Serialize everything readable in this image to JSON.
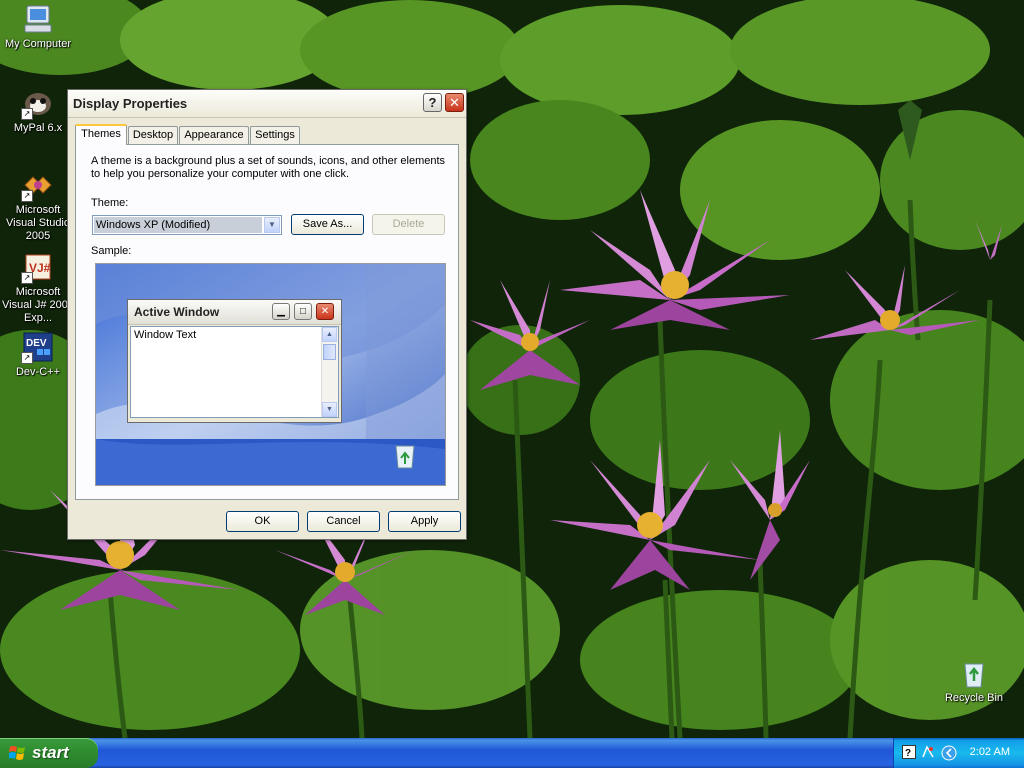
{
  "desktop": {
    "icons": [
      {
        "label": "My Computer"
      },
      {
        "label": "MyPal 6.x"
      },
      {
        "label": "Microsoft Visual Studio 2005"
      },
      {
        "label": "Microsoft Visual J# 2005 Exp..."
      },
      {
        "label": "Dev-C++"
      },
      {
        "label": "Recycle Bin"
      }
    ]
  },
  "dialog": {
    "title": "Display Properties",
    "help_glyph": "?",
    "close_glyph": "✕",
    "tabs": [
      {
        "label": "Themes",
        "active": true
      },
      {
        "label": "Desktop",
        "active": false
      },
      {
        "label": "Appearance",
        "active": false
      },
      {
        "label": "Settings",
        "active": false
      }
    ],
    "description": "A theme is a background plus a set of sounds, icons, and other elements to help you personalize your computer with one click.",
    "theme_label": "Theme:",
    "theme_value": "Windows XP (Modified)",
    "save_as_label": "Save As...",
    "delete_label": "Delete",
    "sample_label": "Sample:",
    "sample_window": {
      "title": "Active Window",
      "body_text": "Window Text"
    },
    "ok_label": "OK",
    "cancel_label": "Cancel",
    "apply_label": "Apply"
  },
  "taskbar": {
    "start_label": "start",
    "clock": "2:02 AM"
  },
  "colors": {
    "taskbar_blue": "#2157d7",
    "start_green": "#2f8f2f",
    "tray_blue": "#18b9ed",
    "dialog_face": "#ece9d8",
    "active_tab_accent": "#ffc83c"
  }
}
